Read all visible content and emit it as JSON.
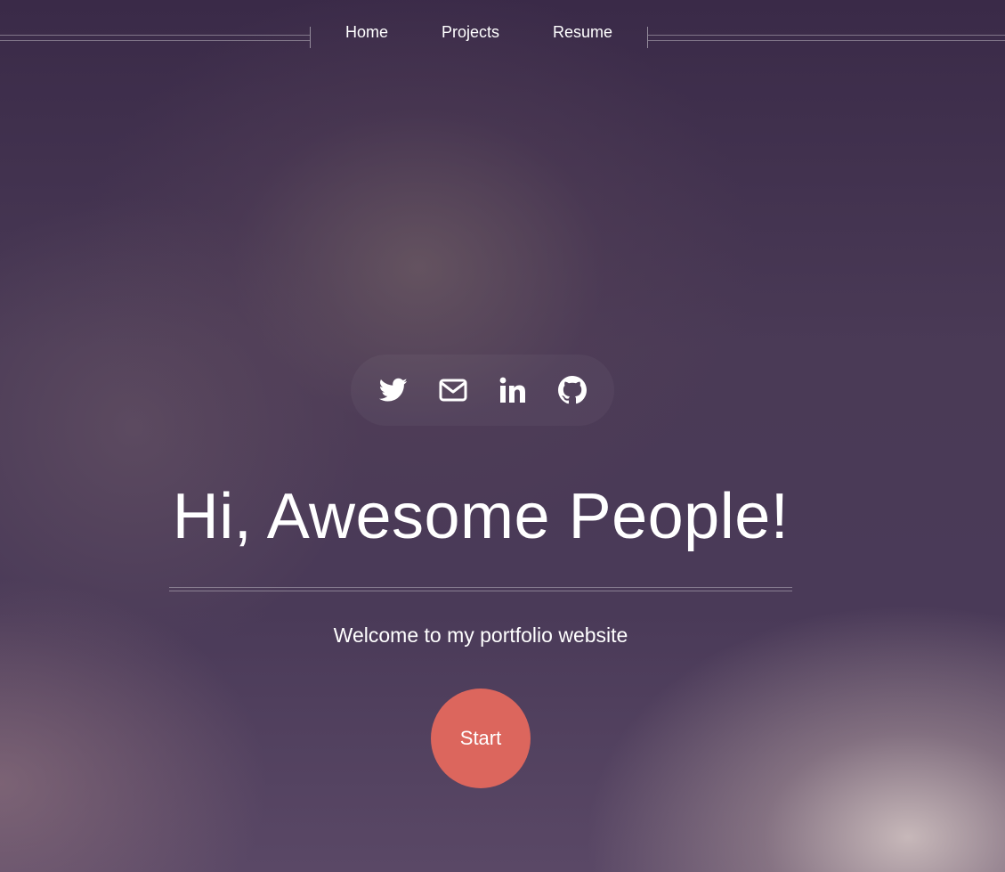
{
  "nav": {
    "items": [
      {
        "label": "Home"
      },
      {
        "label": "Projects"
      },
      {
        "label": "Resume"
      }
    ]
  },
  "social": {
    "icons": [
      "twitter-icon",
      "mail-icon",
      "linkedin-icon",
      "github-icon"
    ]
  },
  "hero": {
    "title": "Hi, Awesome People!",
    "subtitle": "Welcome to my portfolio website",
    "cta_label": "Start"
  },
  "colors": {
    "accent": "#dc665d",
    "text": "#ffffff",
    "background": "#4a3a56"
  }
}
